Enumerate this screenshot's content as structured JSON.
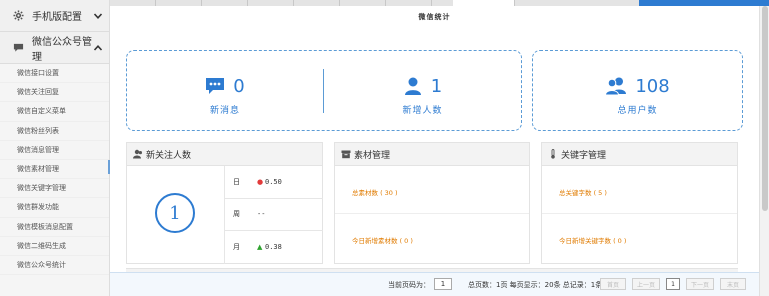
{
  "sidebar": {
    "section_mobile": {
      "label": "手机版配置",
      "icon": "gear-icon"
    },
    "section_wechat": {
      "label": "微信公众号管理",
      "icon": "chat-bubble-icon"
    },
    "items": [
      {
        "label": "微信接口设置"
      },
      {
        "label": "微信关注回复"
      },
      {
        "label": "微信自定义菜单"
      },
      {
        "label": "微信粉丝列表"
      },
      {
        "label": "微信消息管理"
      },
      {
        "label": "微信素材管理"
      },
      {
        "label": "微信关键字管理"
      },
      {
        "label": "微信群发功能"
      },
      {
        "label": "微信模板消息配置"
      },
      {
        "label": "微信二维码生成"
      },
      {
        "label": "微信公众号统计"
      }
    ]
  },
  "page": {
    "title": "微信统计"
  },
  "stats": {
    "new_messages": {
      "value": "0",
      "label": "新消息",
      "icon": "message-icon"
    },
    "new_users": {
      "value": "1",
      "label": "新增人数",
      "icon": "user-icon"
    },
    "total_users": {
      "value": "108",
      "label": "总用户数",
      "icon": "users-icon"
    }
  },
  "new_follow": {
    "title": "新关注人数",
    "icon": "user-group-icon",
    "total": "1",
    "rows": [
      {
        "key": "日",
        "trend": "down",
        "value": "0.50"
      },
      {
        "key": "周",
        "trend": "none",
        "value": "--"
      },
      {
        "key": "月",
        "trend": "up",
        "value": "0.38"
      }
    ]
  },
  "material": {
    "title": "素材管理",
    "icon": "archive-icon",
    "total_label": "总素材数 ( 30 )",
    "today_label": "今日新增素材数 ( 0 )"
  },
  "keyword": {
    "title": "关键字管理",
    "icon": "thermometer-icon",
    "total_label": "总关键字数 ( 5 )",
    "today_label": "今日新增关键字数 ( 0 )"
  },
  "pager": {
    "current_label": "当前页码为：",
    "current_value": "1",
    "summary": "总页数：1页  每页显示：20条  总记录：1条",
    "first": "首页",
    "prev": "上一页",
    "page": "1",
    "next": "下一页",
    "last": "末页"
  },
  "colors": {
    "accent": "#2d7bd1",
    "link": "#e07b00",
    "down": "#e23b3b",
    "up": "#2fa32f"
  }
}
